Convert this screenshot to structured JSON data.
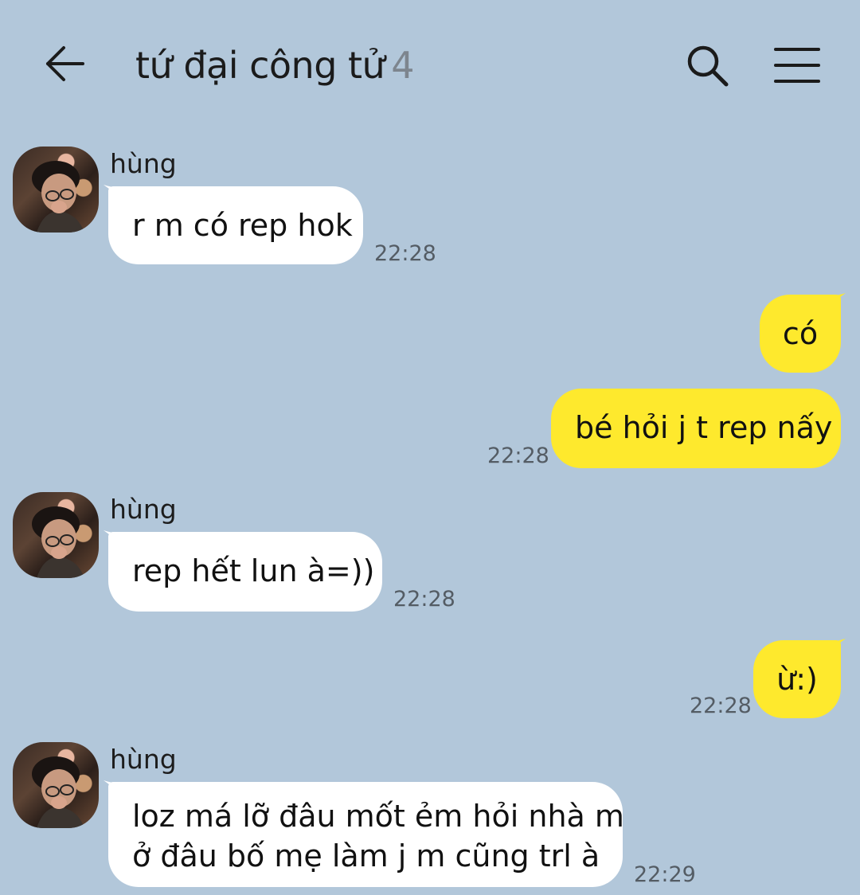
{
  "header": {
    "title": "tứ đại công tử",
    "member_count": "4"
  },
  "messages": [
    {
      "sender": "hùng",
      "text": "r m có rep hok",
      "time": "22:28"
    },
    {
      "text": "có"
    },
    {
      "text": "bé hỏi j t rep nấy",
      "time": "22:28"
    },
    {
      "sender": "hùng",
      "text": "rep hết lun à=))",
      "time": "22:28"
    },
    {
      "text": "ừ:)",
      "time": "22:28"
    },
    {
      "sender": "hùng",
      "text_line1": "loz má lỡ đâu mốt ẻm hỏi nhà m",
      "text_line2": "ở đâu bố mẹ làm j m cũng trl à",
      "time": "22:29"
    }
  ],
  "colors": {
    "background": "#b2c7da",
    "incoming_bubble": "#ffffff",
    "outgoing_bubble": "#fee92d"
  },
  "icons": [
    "back-arrow-icon",
    "search-icon",
    "menu-icon"
  ]
}
